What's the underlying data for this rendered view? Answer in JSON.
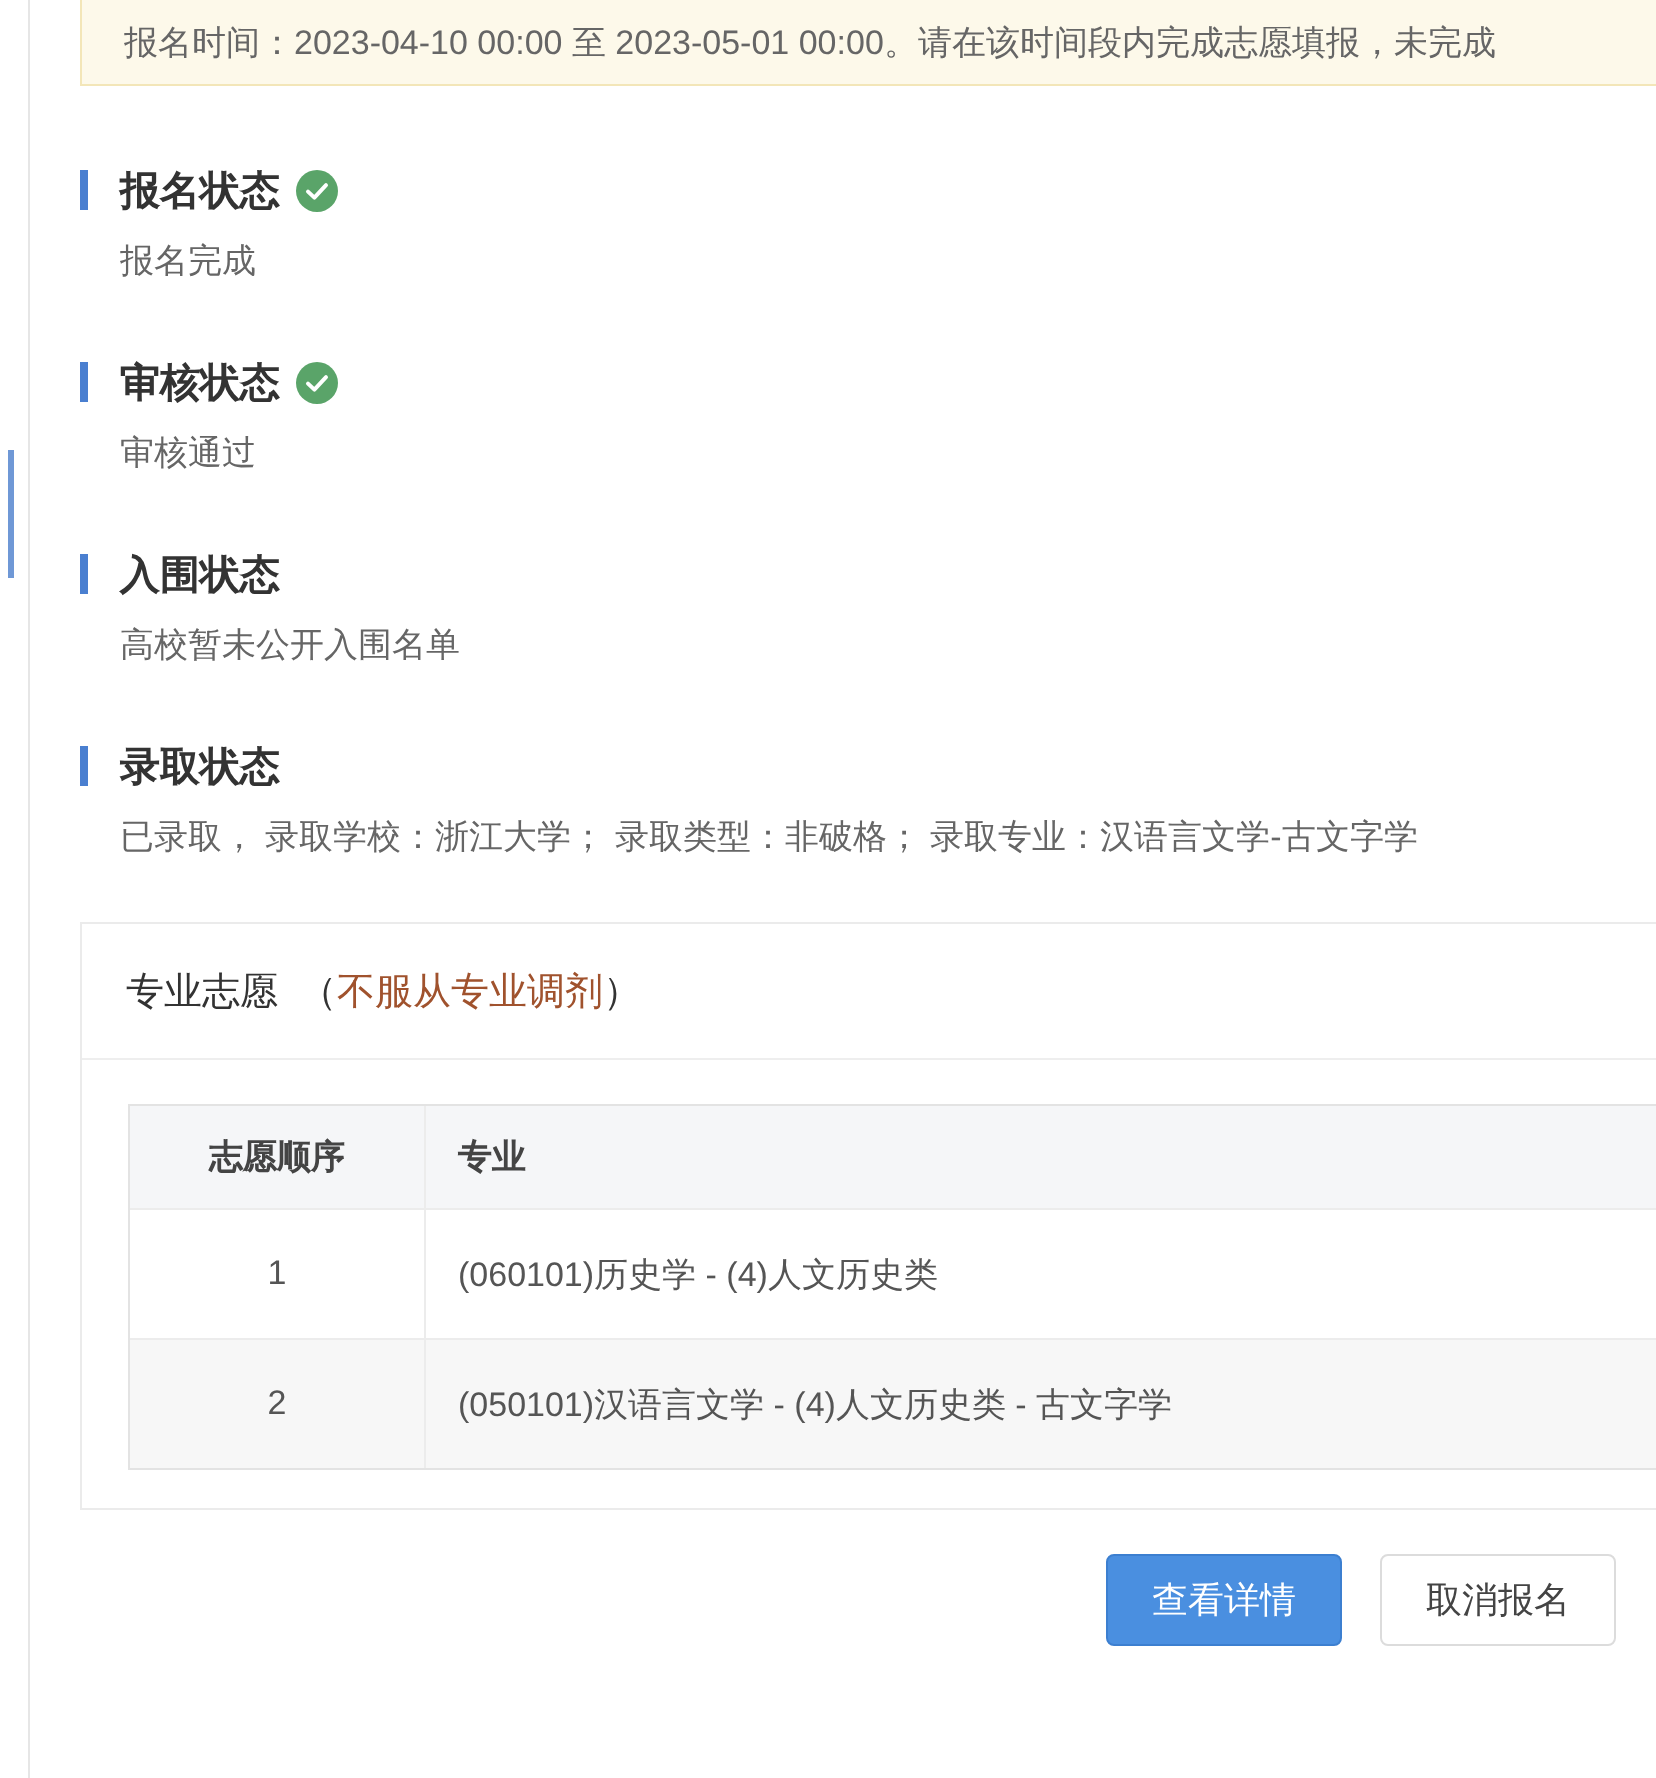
{
  "notice": {
    "text": "报名时间：2023-04-10 00:00 至 2023-05-01 00:00。请在该时间段内完成志愿填报，未完成"
  },
  "sections": [
    {
      "title": "报名状态",
      "verified": true,
      "text": "报名完成"
    },
    {
      "title": "审核状态",
      "verified": true,
      "text": "审核通过"
    },
    {
      "title": "入围状态",
      "verified": false,
      "text": "高校暂未公开入围名单"
    },
    {
      "title": "录取状态",
      "verified": false,
      "text": "已录取， 录取学校：浙江大学； 录取类型：非破格； 录取专业：汉语言文学-古文字学"
    }
  ],
  "preferences": {
    "title": "专业志愿",
    "note_open": "（",
    "note": "不服从专业调剂",
    "note_close": "）",
    "columns": [
      "志愿顺序",
      "专业"
    ],
    "rows": [
      {
        "order": "1",
        "major": "(060101)历史学 - (4)人文历史类"
      },
      {
        "order": "2",
        "major": "(050101)汉语言文学 - (4)人文历史类 - 古文字学"
      }
    ]
  },
  "buttons": [
    {
      "label": "查看详情",
      "kind": "primary"
    },
    {
      "label": "取消报名",
      "kind": "default"
    }
  ]
}
